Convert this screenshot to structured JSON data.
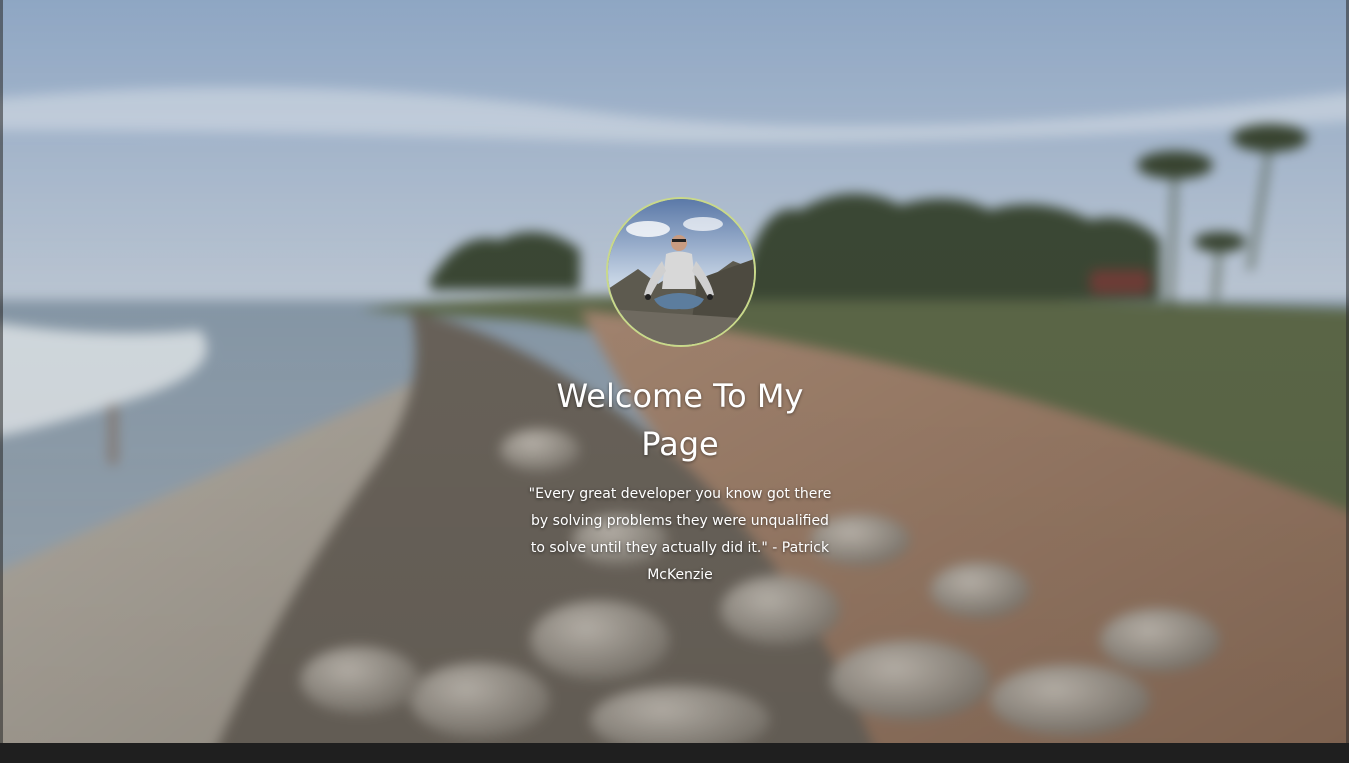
{
  "hero": {
    "title": "Welcome To My Page",
    "quote": "\"Every great developer you know got there by solving problems they were unqualified to solve until they actually did it.\" - Patrick McKenzie",
    "background_description": "blurred coastal beach scene",
    "avatar_alt": "profile photo"
  },
  "colors": {
    "text": "#ffffff",
    "avatar_border": "#c9d98a",
    "footer": "#1f1f1f"
  }
}
